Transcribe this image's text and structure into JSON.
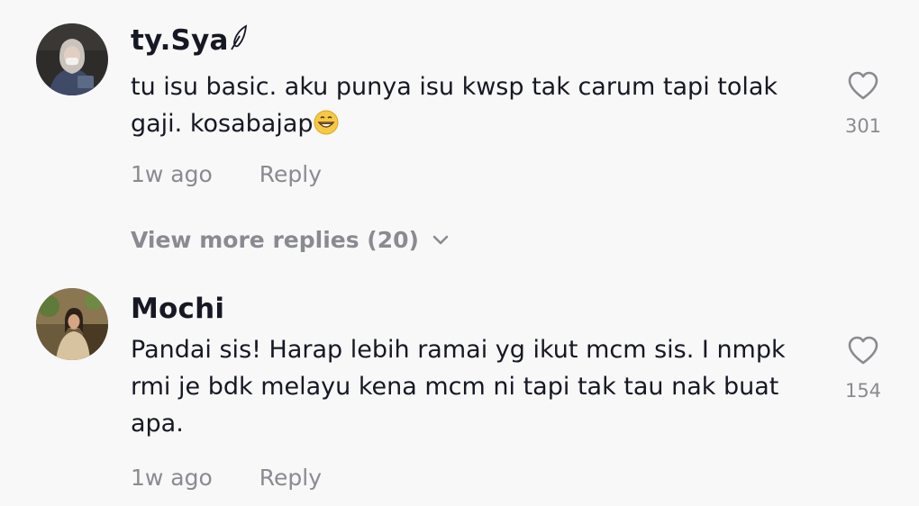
{
  "comments": [
    {
      "username": "ty.Sya",
      "username_icon": "feather-icon",
      "text": "tu isu basic. aku punya isu kwsp tak carum tapi tolak gaji. kosabajap",
      "text_emoji": "grinning-face-emoji",
      "time": "1w ago",
      "reply_label": "Reply",
      "likes": "301",
      "view_more": "View more replies (20)"
    },
    {
      "username": "Mochi",
      "text": "Pandai sis! Harap lebih ramai yg ikut mcm sis. I nmpk rmi je bdk melayu kena mcm ni tapi tak tau nak buat apa.",
      "time": "1w ago",
      "reply_label": "Reply",
      "likes": "154"
    }
  ],
  "colors": {
    "background": "#f8f8f8",
    "text": "#161823",
    "secondary": "#8a8b91"
  }
}
